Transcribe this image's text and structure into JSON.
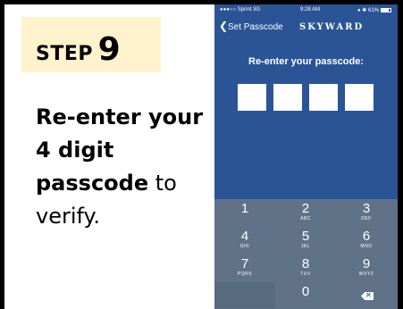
{
  "step": {
    "word": "STEP",
    "number": "9"
  },
  "instructions": {
    "bold_line1": "Re-enter your",
    "bold_line2": "4 digit",
    "bold_line3": "passcode",
    "tail3": " to",
    "line4": "verify."
  },
  "phone": {
    "status_bar": {
      "carrier": "●●●○○ Sprint  3G",
      "time": "9:28 AM",
      "battery": "● ✱ 61%"
    },
    "nav": {
      "back_label": "Set Passcode",
      "brand": "SKYWARD"
    },
    "prompt": "Re-enter your passcode:",
    "passcode_boxes": 4,
    "keypad": [
      {
        "num": "1",
        "letters": ""
      },
      {
        "num": "2",
        "letters": "ABC"
      },
      {
        "num": "3",
        "letters": "DEF"
      },
      {
        "num": "4",
        "letters": "GHI"
      },
      {
        "num": "5",
        "letters": "JKL"
      },
      {
        "num": "6",
        "letters": "MNO"
      },
      {
        "num": "7",
        "letters": "PQRS"
      },
      {
        "num": "8",
        "letters": "TUV"
      },
      {
        "num": "9",
        "letters": "WXYZ"
      },
      {
        "num": "0",
        "letters": ""
      }
    ],
    "delete_icon": "backspace-icon"
  },
  "colors": {
    "step_background": "#fff2cc",
    "phone_background": "#2a5496",
    "keypad_background": "#5f7288"
  }
}
